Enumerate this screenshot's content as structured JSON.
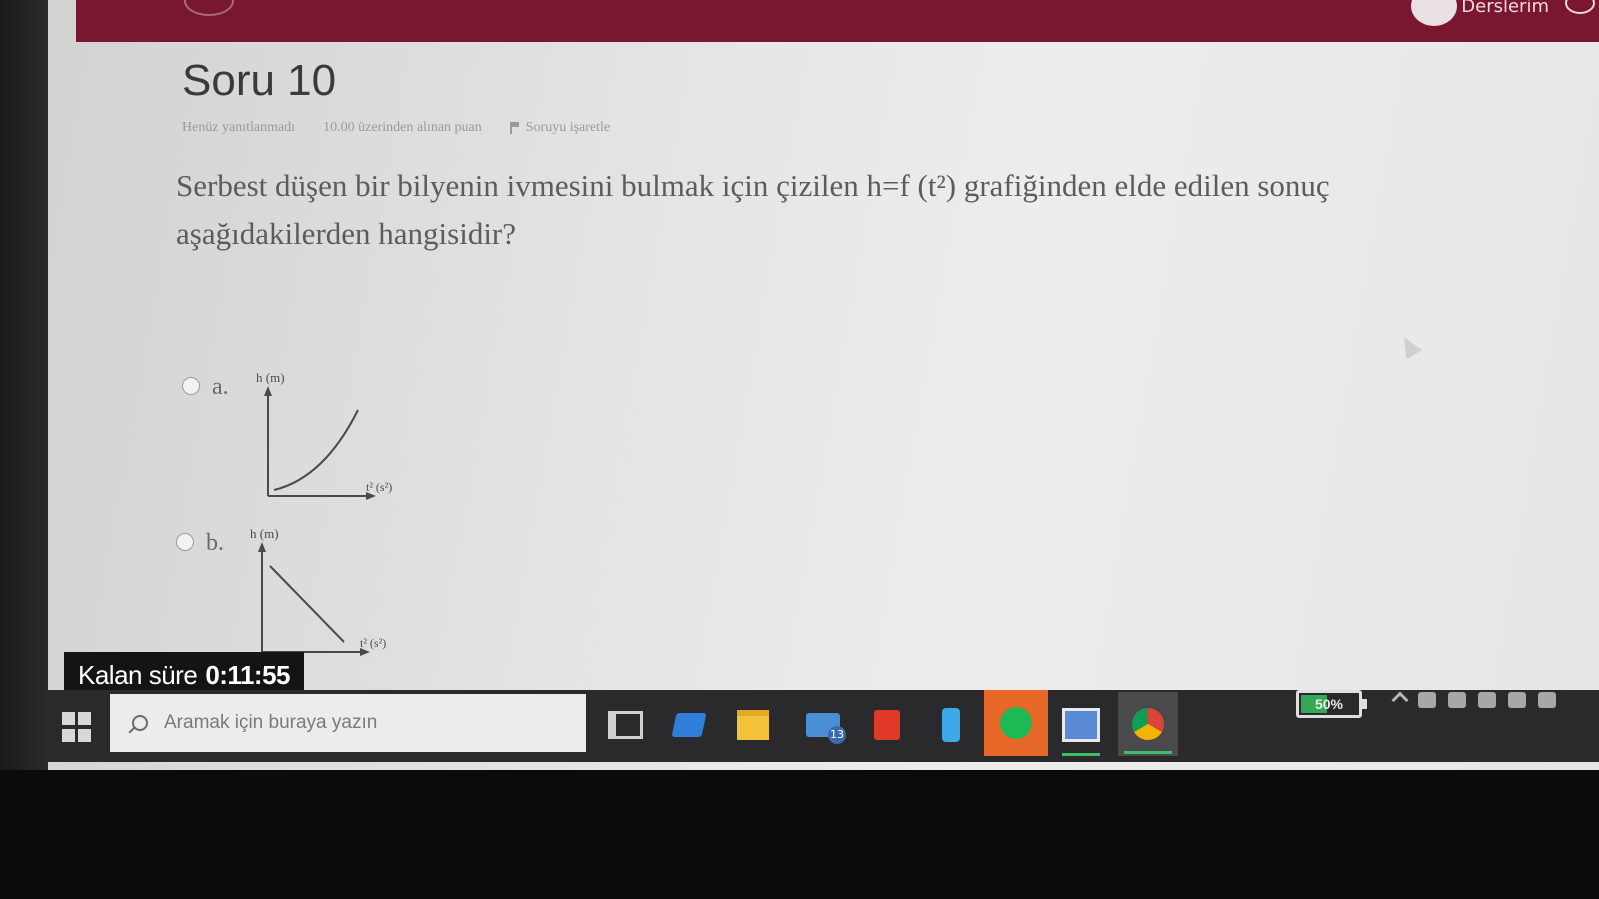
{
  "header": {
    "nav_courses": "Derslerim"
  },
  "question": {
    "title": "Soru 10",
    "status": "Henüz yanıtlanmadı",
    "points": "10.00 üzerinden alınan puan",
    "flag_label": "Soruyu işaretle",
    "text": "Serbest düşen bir bilyenin ivmesini bulmak için çizilen h=f (t²) grafiğinden elde edilen sonuç aşağıdakilerden hangisidir?"
  },
  "options": [
    {
      "letter": "a.",
      "ylabel": "h (m)",
      "xlabel": "t² (s²)",
      "curve": "increasing-concave-up"
    },
    {
      "letter": "b.",
      "ylabel": "h (m)",
      "xlabel": "t² (s²)",
      "curve": "decreasing-linear"
    }
  ],
  "timer": {
    "label": "Kalan süre",
    "value": "0:11:55"
  },
  "taskbar": {
    "search_placeholder": "Aramak için buraya yazın",
    "mail_badge": "13",
    "battery": "50%",
    "battery_level": 0.5,
    "icons": [
      "task-view-icon",
      "teamviewer-icon",
      "file-explorer-icon",
      "mail-icon",
      "office-icon",
      "phone-icon",
      "spotify-icon",
      "photos-icon",
      "chrome-icon"
    ]
  },
  "colors": {
    "header_bg": "#7a1730",
    "timer_bg": "#141414",
    "taskbar_bg": "#2a2a2c",
    "spotify_bg": "#e8682a"
  }
}
